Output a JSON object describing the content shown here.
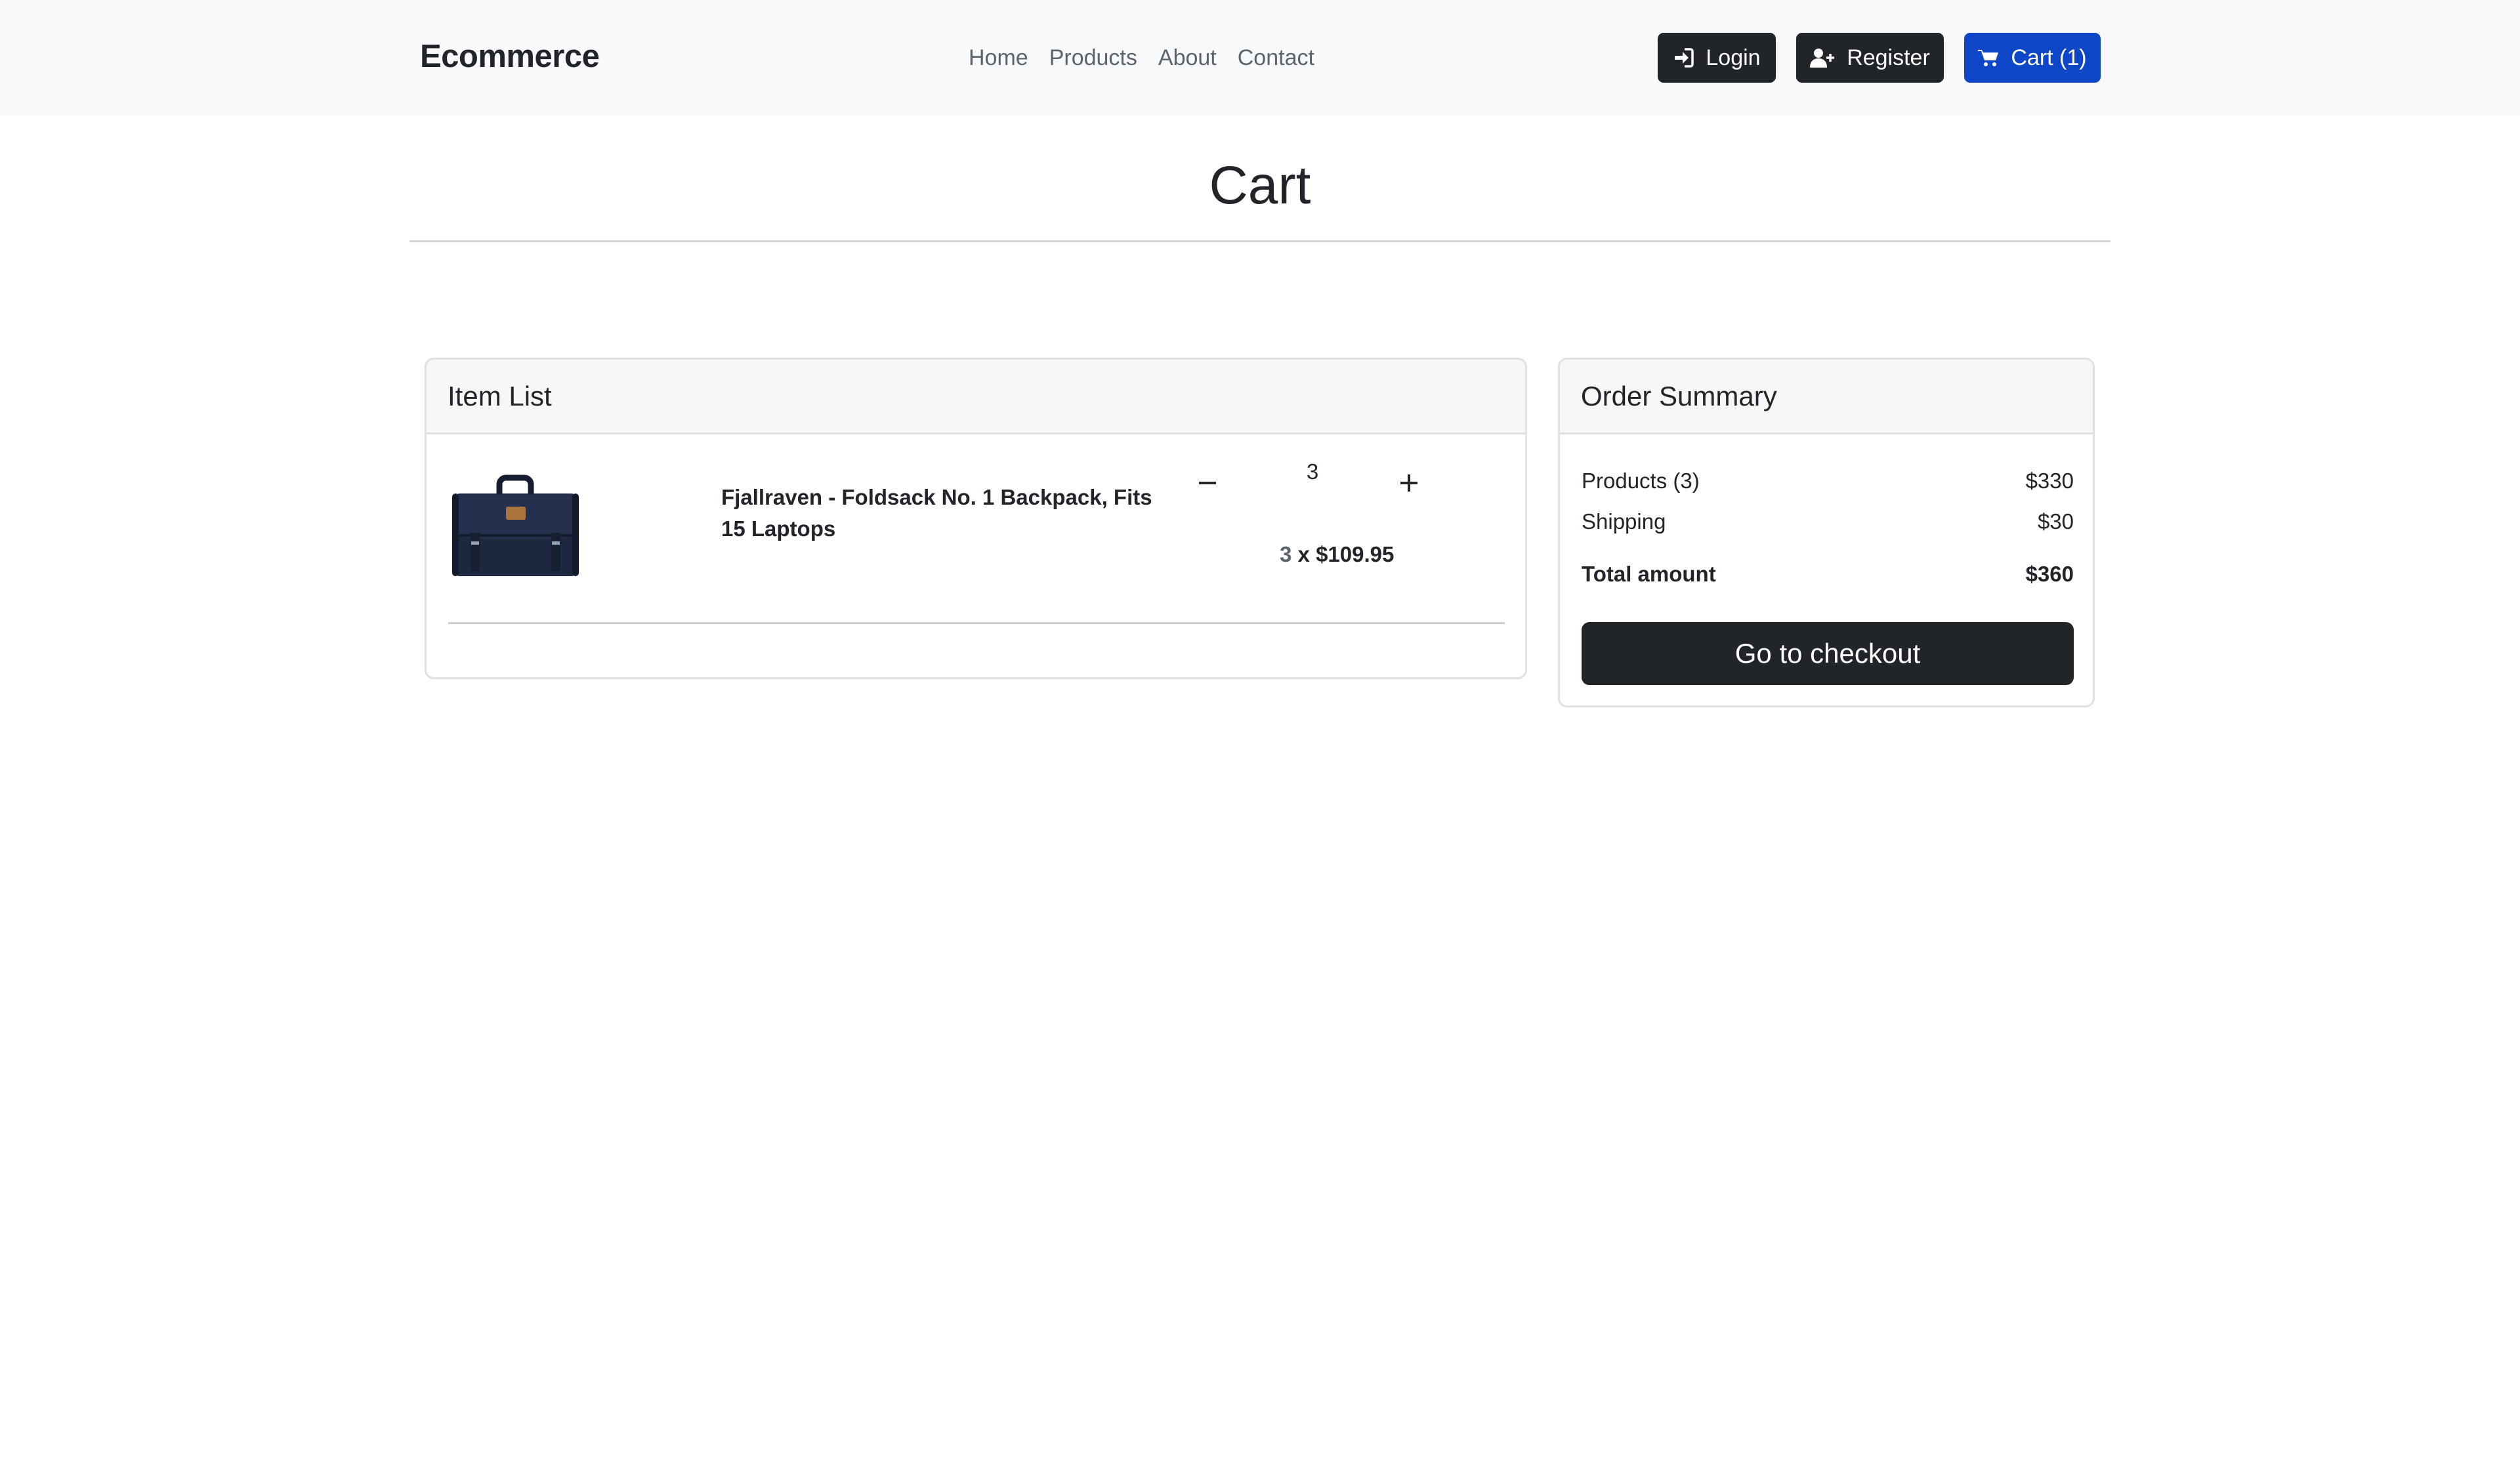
{
  "navbar": {
    "brand": "Ecommerce",
    "links": [
      "Home",
      "Products",
      "About",
      "Contact"
    ],
    "login_label": "Login",
    "register_label": "Register",
    "cart_label": "Cart (1)",
    "cart_color": "#0d47c7"
  },
  "page": {
    "title": "Cart"
  },
  "item_list": {
    "header": "Item List",
    "items": [
      {
        "name": "Fjallraven - Foldsack No. 1 Backpack, Fits 15 Laptops",
        "image_icon": "backpack-image",
        "quantity": "3",
        "price_qty": "3",
        "price_sep": " x ",
        "unit_price": "$109.95"
      }
    ]
  },
  "order_summary": {
    "header": "Order Summary",
    "products_label": "Products (3)",
    "products_value": "$330",
    "shipping_label": "Shipping",
    "shipping_value": "$30",
    "total_label": "Total amount",
    "total_value": "$360",
    "checkout_label": "Go to checkout"
  }
}
